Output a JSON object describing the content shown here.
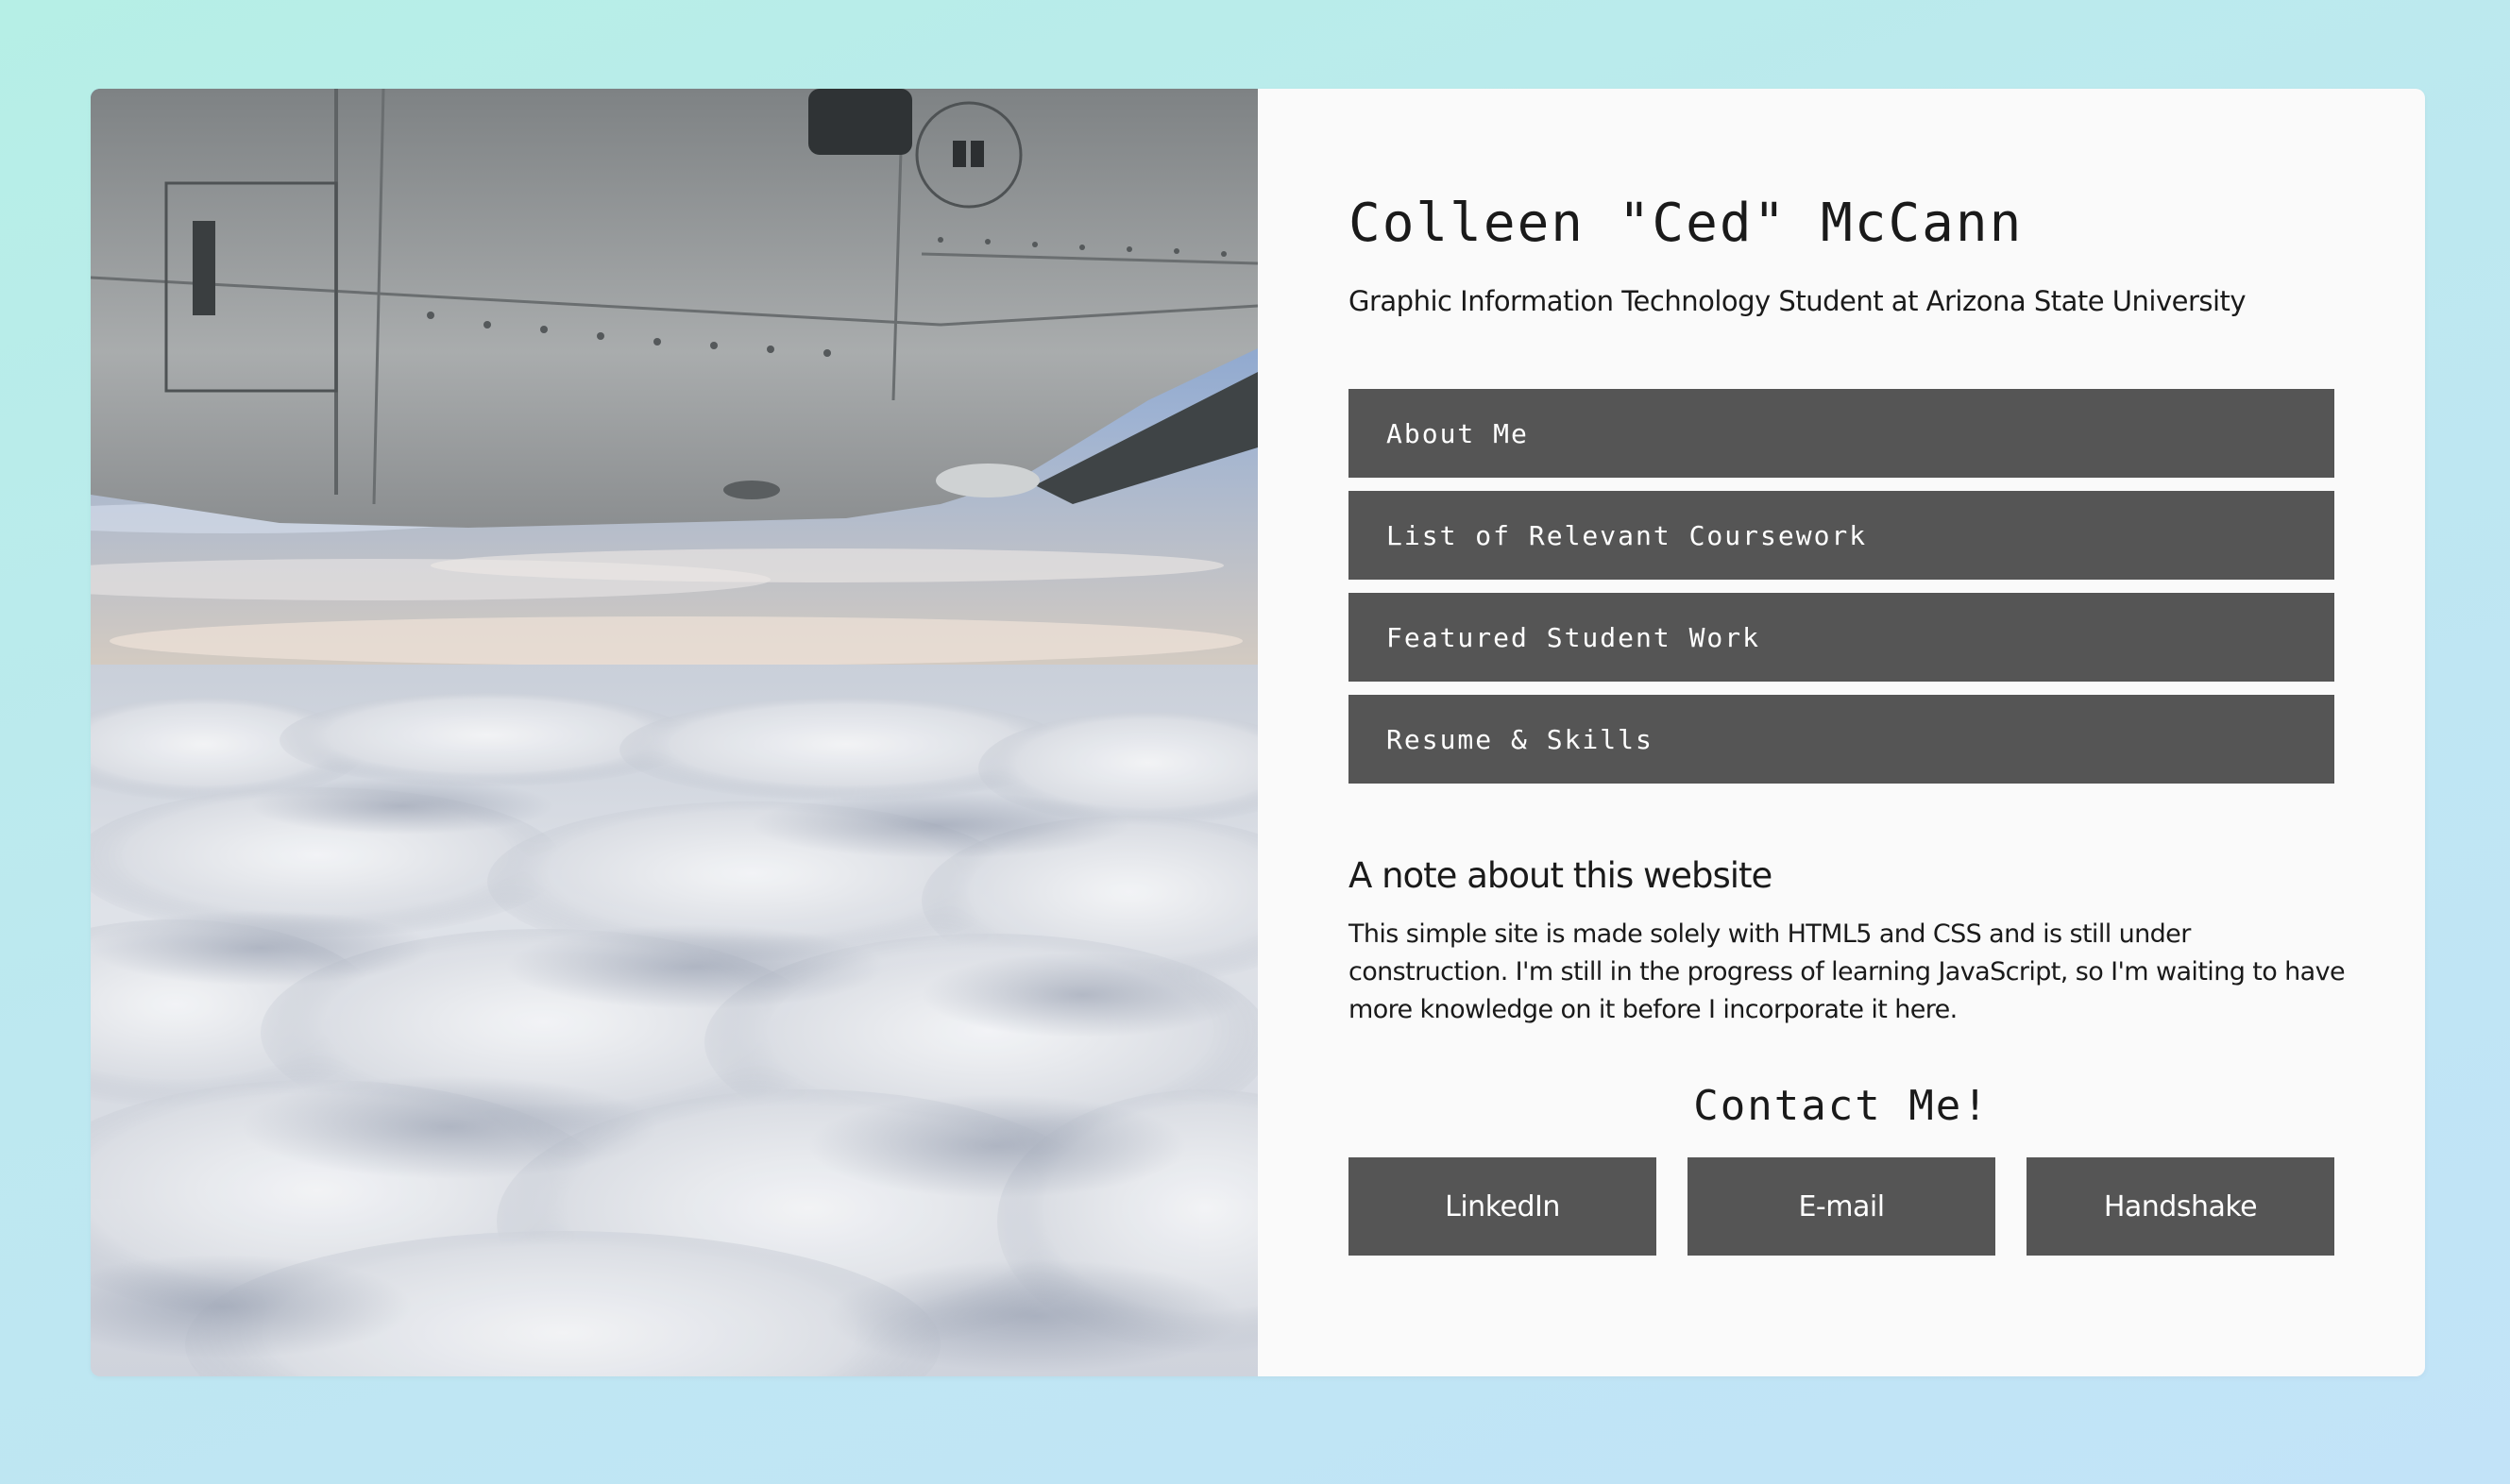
{
  "profile": {
    "name": "Colleen \"Ced\" McCann",
    "subtitle": "Graphic Information Technology Student at Arizona State University"
  },
  "nav": {
    "items": [
      {
        "label": "About Me"
      },
      {
        "label": "List of Relevant Coursework"
      },
      {
        "label": "Featured Student Work"
      },
      {
        "label": "Resume & Skills"
      }
    ]
  },
  "note": {
    "title": "A note about this website",
    "body": "This simple site is made solely with HTML5 and CSS and is still under construction. I'm still in the progress of learning JavaScript, so I'm waiting to have more knowledge on it before I incorporate it here."
  },
  "contact": {
    "title": "Contact Me!",
    "buttons": [
      {
        "label": "LinkedIn"
      },
      {
        "label": "E-mail"
      },
      {
        "label": "Handshake"
      }
    ]
  },
  "colors": {
    "button_bg": "#555555",
    "button_text": "#ffffff",
    "panel_bg": "#fafafa",
    "page_gradient_start": "#b6efe6",
    "page_gradient_end": "#c2e3f8"
  },
  "photo": {
    "subject": "airplane-wing-above-clouds"
  }
}
